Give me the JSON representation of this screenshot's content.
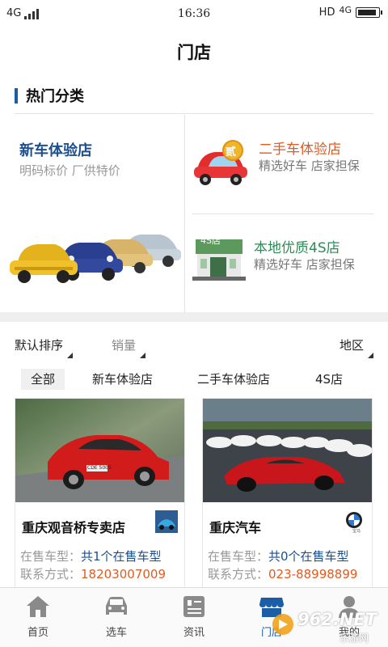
{
  "status_bar": {
    "network": "4G",
    "time": "16:36",
    "hd": "HD",
    "network_right": "4G"
  },
  "header": {
    "title": "门店"
  },
  "hot_categories": {
    "title": "热门分类",
    "new_car": {
      "name": "新车体验店",
      "desc": "明码标价 厂供特价"
    },
    "used_car": {
      "name": "二手车体验店",
      "desc": "精选好车 店家担保",
      "badge": "贰"
    },
    "local_4s": {
      "name": "本地优质4S店",
      "desc": "精选好车 店家担保",
      "sign": "4S店"
    }
  },
  "sort_bar": {
    "default": "默认排序",
    "sales": "销量",
    "region": "地区"
  },
  "filter_tabs": [
    "全部",
    "新车体验店",
    "二手车体验店",
    "4S店"
  ],
  "shops": [
    {
      "name": "重庆观音桥专卖店",
      "models_label": "在售车型：",
      "models_value": "共1个在售车型",
      "contact_label": "联系方式：",
      "contact_value": "18203007009",
      "plate": "CDE 5005"
    },
    {
      "name": "重庆汽车",
      "models_label": "在售车型：",
      "models_value": "共0个在售车型",
      "contact_label": "联系方式：",
      "contact_value": "023-88998899",
      "logo_text": "宝马"
    }
  ],
  "tab_bar": {
    "items": [
      {
        "label": "首页",
        "icon": "home-icon"
      },
      {
        "label": "选车",
        "icon": "car-icon"
      },
      {
        "label": "资讯",
        "icon": "news-icon"
      },
      {
        "label": "门店",
        "icon": "store-icon"
      },
      {
        "label": "我的",
        "icon": "user-icon"
      }
    ],
    "active_index": 3
  },
  "watermark": {
    "text": "962.NET",
    "sub": "乐游网"
  },
  "colors": {
    "accent": "#1b5ea5",
    "orange": "#e35a1f",
    "green": "#2e8b57"
  }
}
